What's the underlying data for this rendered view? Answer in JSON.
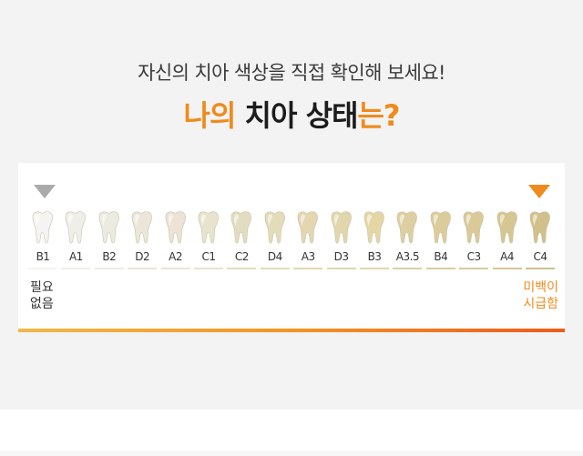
{
  "header": {
    "subtitle": "자신의 치아 색상을 직접 확인해 보세요!",
    "title_part1": "나의",
    "title_part2": "치아 상태",
    "title_part3": "는?"
  },
  "shade_guide": {
    "teeth": [
      {
        "code": "B1",
        "color": "#f4f4f2"
      },
      {
        "code": "A1",
        "color": "#efefe9"
      },
      {
        "code": "B2",
        "color": "#ebebe1"
      },
      {
        "code": "D2",
        "color": "#ece6da"
      },
      {
        "code": "A2",
        "color": "#ece3d6"
      },
      {
        "code": "C1",
        "color": "#e8e3cc"
      },
      {
        "code": "C2",
        "color": "#e2dcc1"
      },
      {
        "code": "D4",
        "color": "#e4dcb8"
      },
      {
        "code": "A3",
        "color": "#e3d6b1"
      },
      {
        "code": "D3",
        "color": "#e2d7ac"
      },
      {
        "code": "B3",
        "color": "#e5d7a5"
      },
      {
        "code": "A3.5",
        "color": "#ddcfa1"
      },
      {
        "code": "B4",
        "color": "#ddcc9b"
      },
      {
        "code": "C3",
        "color": "#d9ca98"
      },
      {
        "code": "A4",
        "color": "#d6c691"
      },
      {
        "code": "C4",
        "color": "#d2c08b"
      }
    ],
    "left_label_line1": "필요",
    "left_label_line2": "없음",
    "right_label_line1": "미백이",
    "right_label_line2": "시급함",
    "left_marker_color": "#aaaaaa",
    "right_marker_color": "#ef8b1d",
    "accent_color": "#ef8b1d"
  }
}
